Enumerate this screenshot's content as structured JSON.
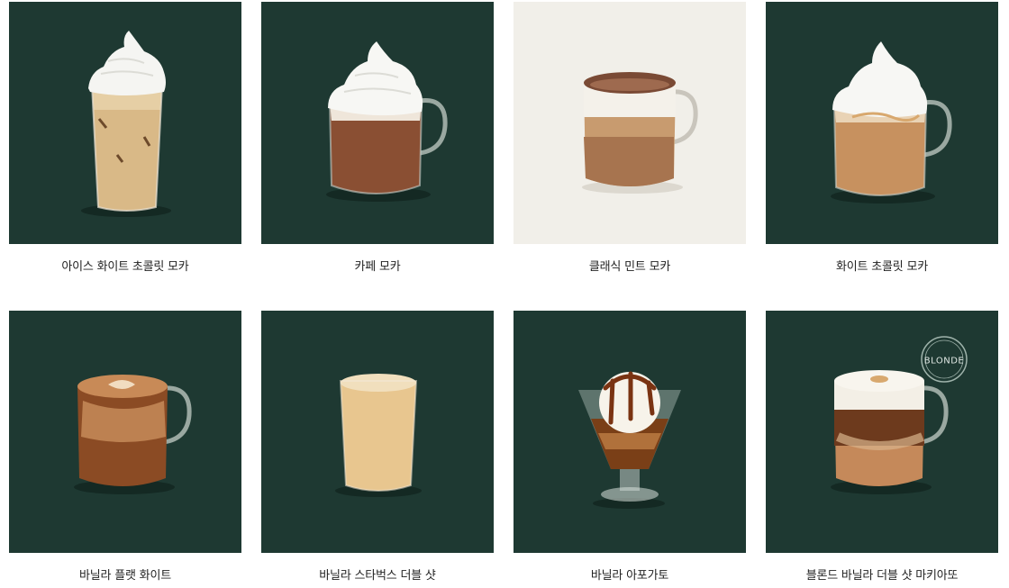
{
  "products": [
    {
      "name": "아이스 화이트 초콜릿 모카",
      "image": "iced-white-chocolate-mocha"
    },
    {
      "name": "카페 모카",
      "image": "caffe-mocha"
    },
    {
      "name": "클래식 민트 모카",
      "image": "classic-mint-mocha"
    },
    {
      "name": "화이트 초콜릿 모카",
      "image": "white-chocolate-mocha"
    },
    {
      "name": "바닐라 플랫 화이트",
      "image": "vanilla-flat-white"
    },
    {
      "name": "바닐라 스타벅스 더블 샷",
      "image": "vanilla-starbucks-double-shot"
    },
    {
      "name": "바닐라 아포가토",
      "image": "vanilla-affogato"
    },
    {
      "name": "블론드 바닐라 더블 샷 마키아또",
      "image": "blonde-vanilla-double-shot-macchiato",
      "badge": "BLONDE"
    }
  ],
  "colors": {
    "card_bg": "#1e3932",
    "card_bg_light": "#f1efe9",
    "text": "#222222"
  }
}
